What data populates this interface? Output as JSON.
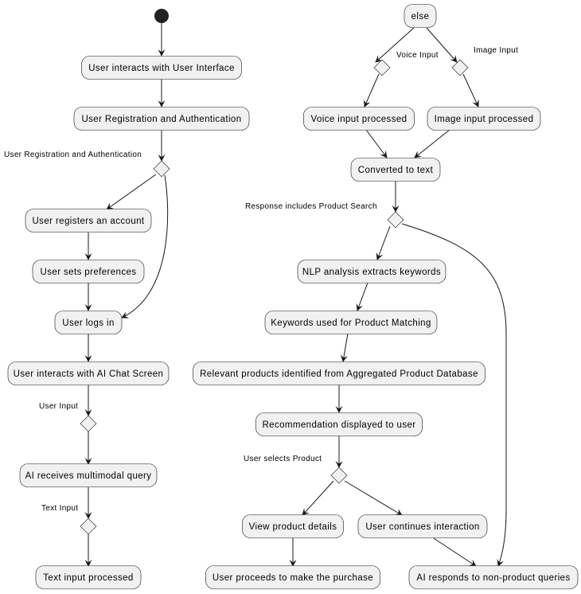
{
  "diagram": {
    "nodes": {
      "n1": "User interacts with User Interface",
      "n2": "User Registration and Authentication",
      "n3": "User registers an account",
      "n4": "User sets preferences",
      "n5": "User logs in",
      "n6": "User interacts with AI Chat Screen",
      "n7": "AI receives multimodal query",
      "n8": "Text input processed",
      "r0": "else",
      "r1": "Voice input processed",
      "r2": "Image input processed",
      "r3": "Converted to text",
      "r4": "NLP analysis extracts keywords",
      "r5": "Keywords used for Product Matching",
      "r6": "Relevant products identified from Aggregated Product Database",
      "r7": "Recommendation displayed to user",
      "r8": "View product details",
      "r9": "User continues interaction",
      "r10": "User proceeds to make the purchase",
      "r11": "AI responds to non-product queries"
    },
    "labels": {
      "l1": "User Registration and Authentication",
      "l2": "User Input",
      "l3": "Text Input",
      "l4": "Voice Input",
      "l5": "Image Input",
      "l6": "Response includes Product Search",
      "l7": "User selects Product"
    },
    "colors": {
      "node_fill": "#f1f1f1",
      "line": "#181818",
      "start": "#222222"
    }
  }
}
